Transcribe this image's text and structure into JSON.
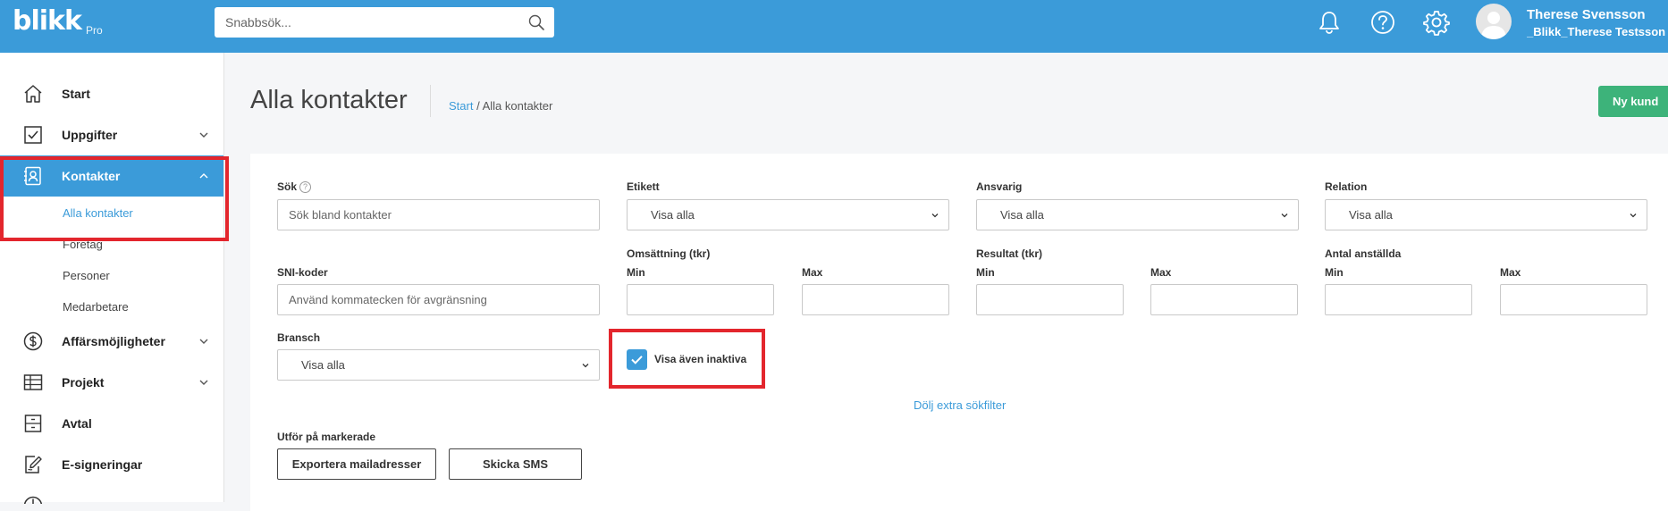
{
  "app": {
    "logo": "blikk",
    "logo_suffix": "Pro"
  },
  "topbar": {
    "search_placeholder": "Snabbsök...",
    "user_name": "Therese Svensson",
    "user_org": "_Blikk_Therese Testsson AB"
  },
  "sidebar": {
    "items": {
      "start": "Start",
      "uppgifter": "Uppgifter",
      "kontakter": "Kontakter",
      "affarsmojligheter": "Affärsmöjligheter",
      "projekt": "Projekt",
      "avtal": "Avtal",
      "esign": "E-signeringar"
    },
    "subitems": {
      "alla": "Alla kontakter",
      "foretag": "Företag",
      "personer": "Personer",
      "medarbetare": "Medarbetare"
    }
  },
  "page": {
    "title": "Alla kontakter",
    "breadcrumb_link": "Start",
    "breadcrumb_sep": " / ",
    "breadcrumb_current": "Alla kontakter",
    "new_button": "Ny kund"
  },
  "filters": {
    "sok_label": "Sök",
    "sok_help": "?",
    "sok_placeholder": "Sök bland kontakter",
    "etikett_label": "Etikett",
    "etikett_value": "Visa alla",
    "ansvarig_label": "Ansvarig",
    "ansvarig_value": "Visa alla",
    "relation_label": "Relation",
    "relation_value": "Visa alla",
    "sni_label": "SNI-koder",
    "sni_placeholder": "Använd kommatecken för avgränsning",
    "omsattning_label": "Omsättning (tkr)",
    "resultat_label": "Resultat (tkr)",
    "anstallda_label": "Antal anställda",
    "min_label": "Min",
    "max_label": "Max",
    "bransch_label": "Bransch",
    "bransch_value": "Visa alla",
    "inactive_label": "Visa även inaktiva",
    "inactive_checked": true,
    "hide_filters_link": "Dölj extra sökfilter"
  },
  "bulk": {
    "label": "Utför på markerade",
    "export_button": "Exportera mailadresser",
    "sms_button": "Skicka SMS"
  },
  "colors": {
    "brand": "#3b9bd9",
    "success": "#3db37a",
    "highlight": "#e3262d"
  }
}
